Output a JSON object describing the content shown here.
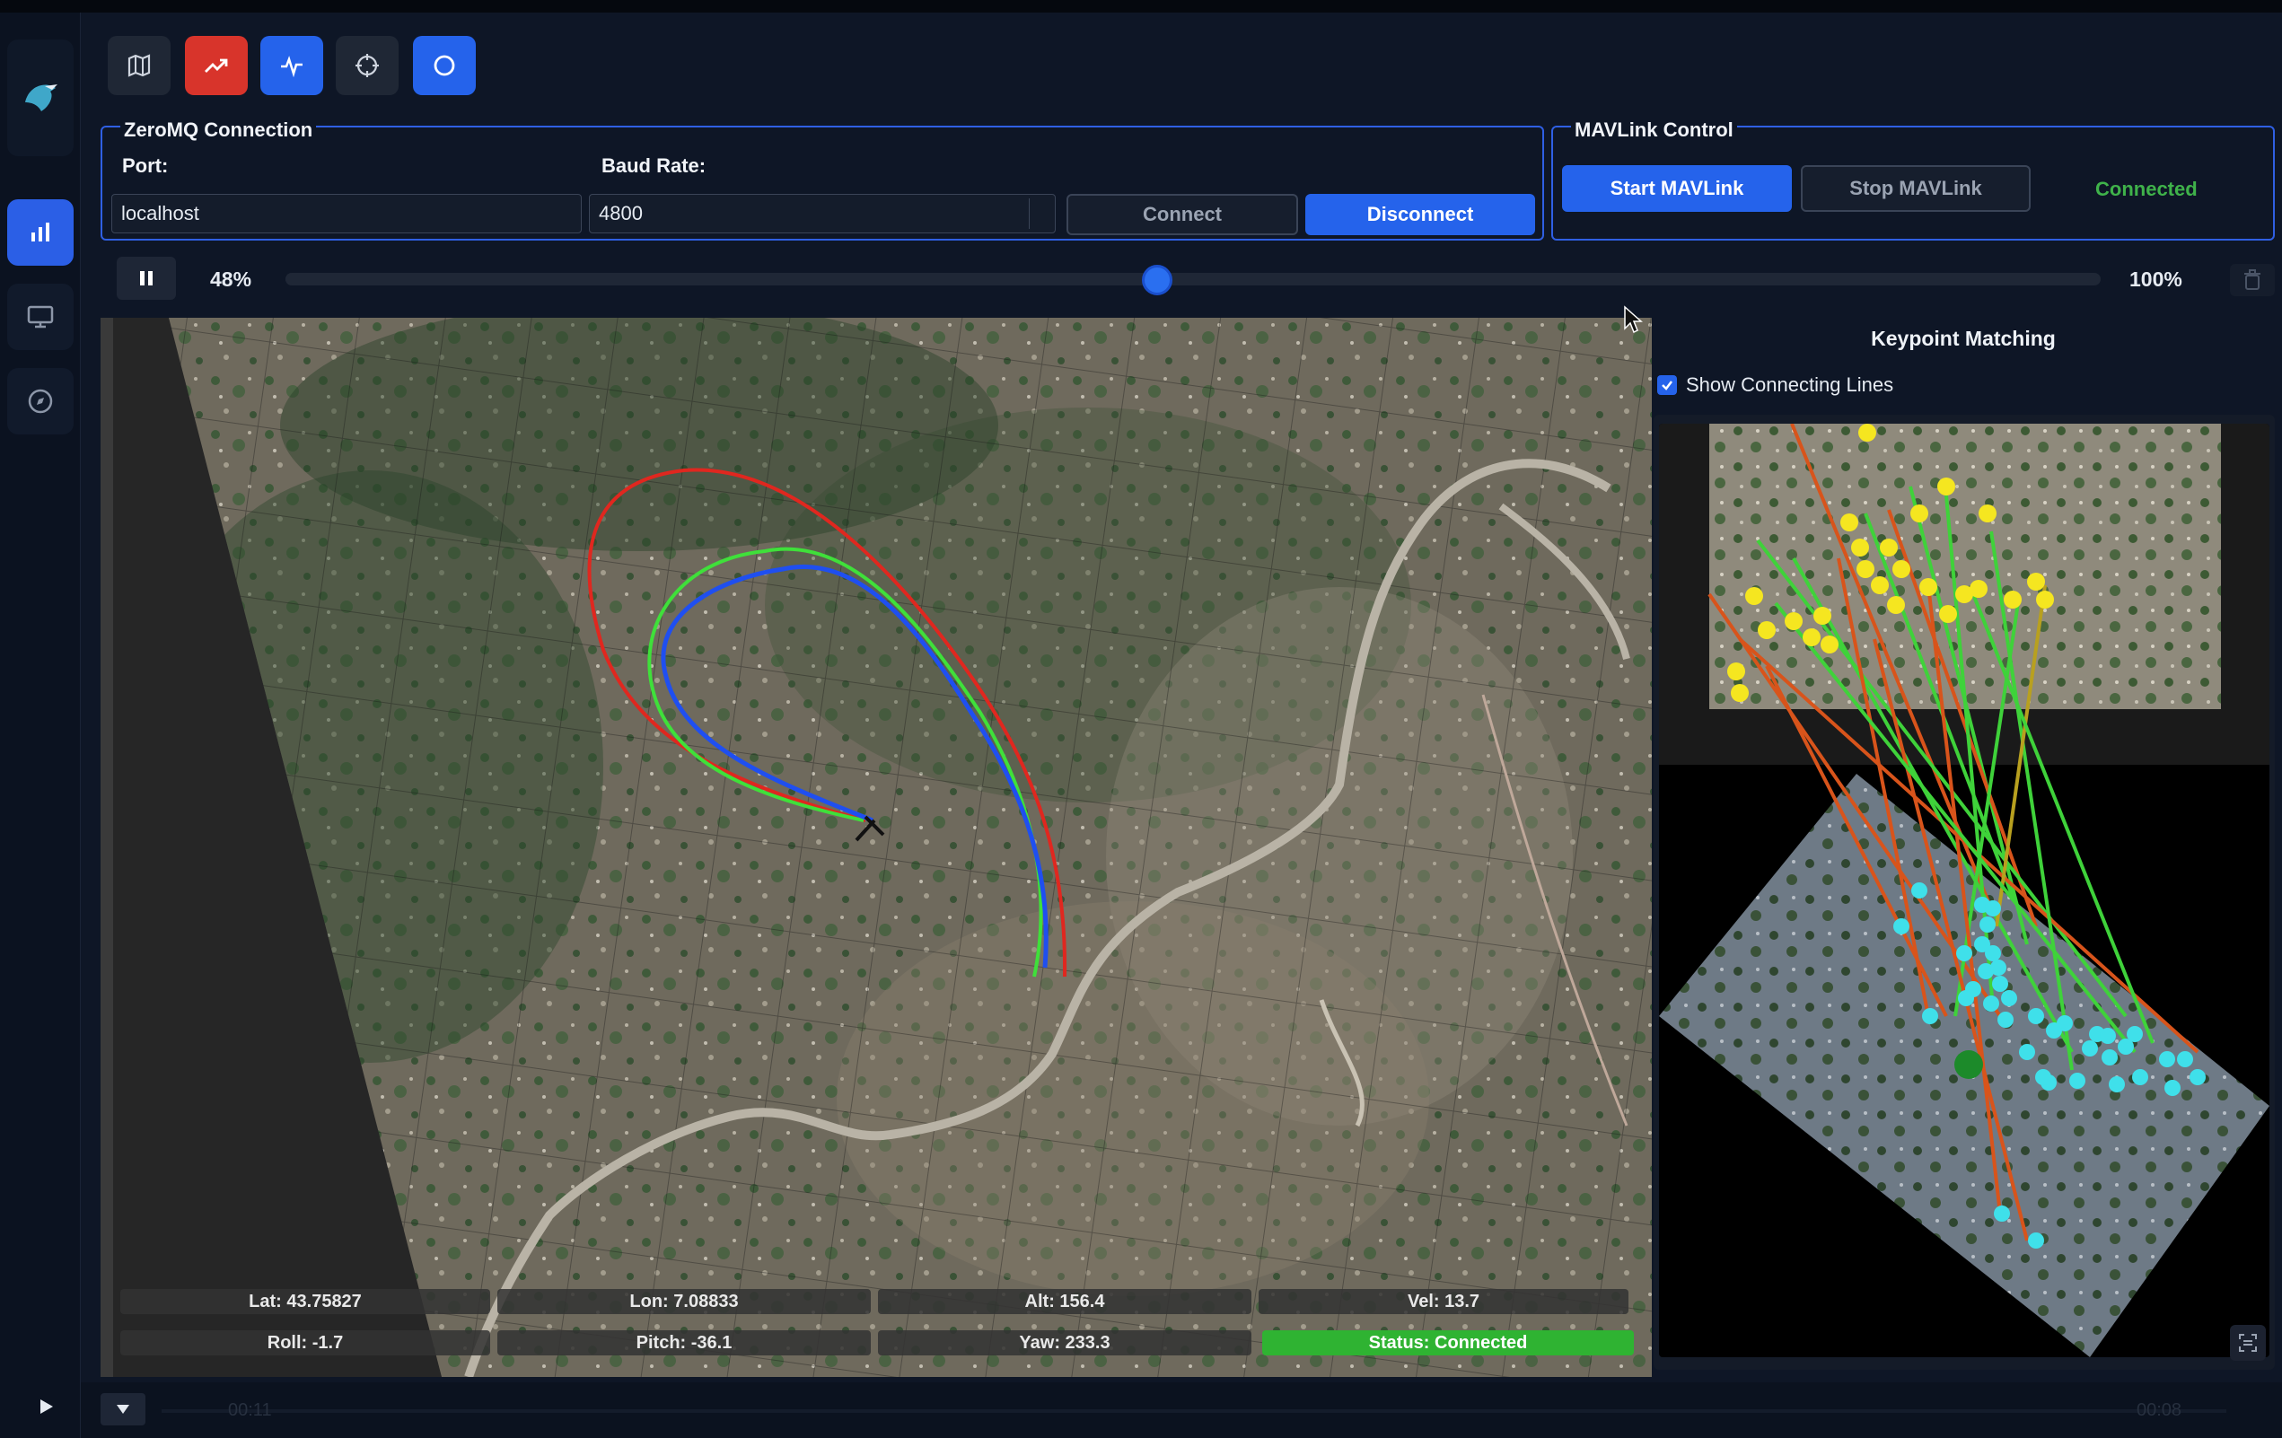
{
  "zmq": {
    "title": "ZeroMQ Connection",
    "port_label": "Port:",
    "port_value": "localhost",
    "baud_label": "Baud Rate:",
    "baud_value": "4800",
    "connect_label": "Connect",
    "disconnect_label": "Disconnect"
  },
  "mavlink": {
    "title": "MAVLink Control",
    "start_label": "Start MAVLink",
    "stop_label": "Stop MAVLink",
    "status": "Connected",
    "status_color": "#3fb24a"
  },
  "playback": {
    "progress_percent": 48,
    "start_label": "48%",
    "end_label": "100%"
  },
  "telemetry": {
    "lat": "Lat: 43.75827",
    "lon": "Lon: 7.08833",
    "alt": "Alt: 156.4",
    "vel": "Vel: 13.7",
    "roll": "Roll: -1.7",
    "pitch": "Pitch: -36.1",
    "yaw": "Yaw: 233.3",
    "status": "Status: Connected"
  },
  "keypoint": {
    "title": "Keypoint Matching",
    "show_lines_label": "Show Connecting Lines",
    "show_lines_checked": true
  },
  "bottom": {
    "time_left": "00:11",
    "time_right": "00:08"
  },
  "icons": {
    "logo": "bird-logo-icon",
    "rail": [
      "chart-icon",
      "monitor-icon",
      "compass-icon"
    ],
    "toolbar": [
      "map-icon",
      "trend-icon",
      "activity-icon",
      "target-icon",
      "circle-icon"
    ]
  },
  "colors": {
    "accent": "#2563eb",
    "danger": "#d8342b",
    "success": "#2fb332",
    "path_red": "#e0271f",
    "path_green": "#3fe03a",
    "path_blue": "#1f4ff0",
    "keypoint_yellow": "#f5e620",
    "keypoint_cyan": "#3fe0ea"
  }
}
